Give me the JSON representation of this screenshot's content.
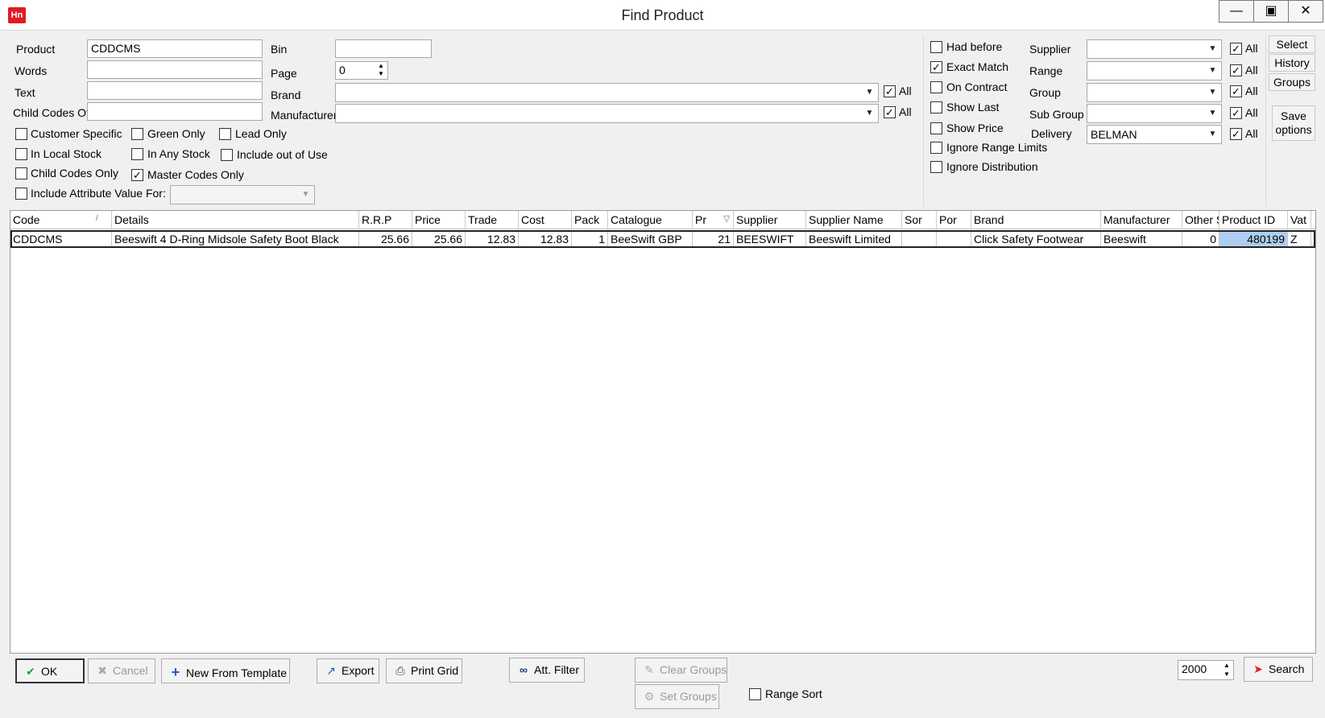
{
  "window": {
    "title": "Find Product",
    "app_icon_text": "Hn"
  },
  "filters": {
    "product_label": "Product",
    "product_value": "CDDCMS",
    "words_label": "Words",
    "text_label": "Text",
    "child_codes_of_label": "Child Codes Of",
    "bin_label": "Bin",
    "page_label": "Page",
    "page_value": "0",
    "brand_label": "Brand",
    "manufacturer_label": "Manufacturer",
    "all_label": "All"
  },
  "options": {
    "customer_specific": "Customer Specific",
    "green_only": "Green Only",
    "lead_only": "Lead Only",
    "in_local_stock": "In Local Stock",
    "in_any_stock": "In Any Stock",
    "include_out_of_use": "Include out of Use",
    "child_codes_only": "Child Codes Only",
    "master_codes_only": "Master Codes Only",
    "include_attribute_value_for": "Include Attribute Value For:"
  },
  "right_options": {
    "had_before": "Had before",
    "exact_match": "Exact Match",
    "on_contract": "On Contract",
    "show_last": "Show Last",
    "show_price": "Show Price",
    "ignore_range_limits": "Ignore Range Limits",
    "ignore_distribution": "Ignore Distribution",
    "supplier_label": "Supplier",
    "range_label": "Range",
    "group_label": "Group",
    "sub_group_label": "Sub Group",
    "delivery_label": "Delivery",
    "delivery_value": "BELMAN",
    "all_label": "All"
  },
  "side_buttons": {
    "select": "Select",
    "history": "History",
    "groups": "Groups",
    "save_line1": "Save",
    "save_line2": "options"
  },
  "grid": {
    "columns": [
      "Code",
      "Details",
      "R.R.P",
      "Price",
      "Trade",
      "Cost",
      "Pack",
      "Catalogue",
      "Pr",
      "Supplier",
      "Supplier Name",
      "Sor",
      "Por",
      "Brand",
      "Manufacturer",
      "Other S",
      "Product ID",
      "Vat"
    ],
    "rows": [
      [
        "CDDCMS",
        "Beeswift 4 D-Ring Midsole Safety Boot Black",
        "25.66",
        "25.66",
        "12.83",
        "12.83",
        "1",
        "BeeSwift GBP",
        "21",
        "BEESWIFT",
        "Beeswift Limited",
        "",
        "",
        "Click Safety Footwear",
        "Beeswift",
        "0",
        "480199",
        "Z"
      ]
    ]
  },
  "bottom": {
    "ok": "OK",
    "cancel": "Cancel",
    "new_from_template": "New From Template",
    "export": "Export",
    "print_grid": "Print Grid",
    "att_filter": "Att. Filter",
    "clear_groups": "Clear Groups",
    "set_groups": "Set Groups",
    "range_sort": "Range Sort",
    "limit_value": "2000",
    "search": "Search"
  },
  "colors": {
    "accent_red": "#e21b24",
    "ok_green": "#1f9e2c",
    "selection_blue": "#aecdf0"
  }
}
